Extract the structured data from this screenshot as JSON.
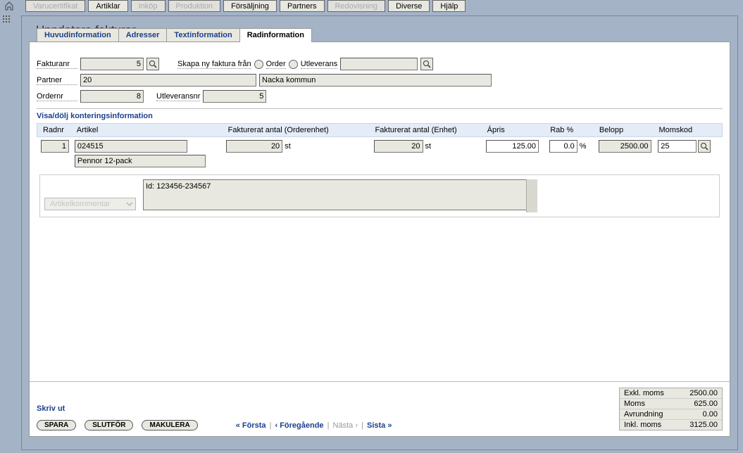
{
  "menu": {
    "items": [
      {
        "label": "Varucertifikat",
        "disabled": true
      },
      {
        "label": "Artiklar",
        "disabled": false
      },
      {
        "label": "Inköp",
        "disabled": true
      },
      {
        "label": "Produktion",
        "disabled": true
      },
      {
        "label": "Försäljning",
        "disabled": false
      },
      {
        "label": "Partners",
        "disabled": false
      },
      {
        "label": "Redovisning",
        "disabled": true
      },
      {
        "label": "Diverse",
        "disabled": false
      },
      {
        "label": "Hjälp",
        "disabled": false
      }
    ]
  },
  "page": {
    "title": "Uppdatera fakturor"
  },
  "tabs": [
    {
      "label": "Huvudinformation",
      "active": false
    },
    {
      "label": "Adresser",
      "active": false
    },
    {
      "label": "Textinformation",
      "active": false
    },
    {
      "label": "Radinformation",
      "active": true
    }
  ],
  "form": {
    "fakturanr_label": "Fakturanr",
    "fakturanr": "5",
    "skapa_label": "Skapa ny faktura från",
    "order_label": "Order",
    "utleverans_label": "Utleverans",
    "skapa_value": "",
    "partner_label": "Partner",
    "partner_code": "20",
    "partner_name": "Nacka kommun",
    "ordernr_label": "Ordernr",
    "ordernr": "8",
    "utleveransnr_label": "Utleveransnr",
    "utleveransnr": "5"
  },
  "section": {
    "toggle_label": "Visa/dölj konteringsinformation"
  },
  "grid": {
    "headers": {
      "radnr": "Radnr",
      "artikel": "Artikel",
      "fakt_order": "Fakturerat antal (Orderenhet)",
      "fakt_enhet": "Fakturerat antal (Enhet)",
      "apris": "Ápris",
      "rab": "Rab %",
      "belopp": "Belopp",
      "momskod": "Momskod"
    },
    "row": {
      "radnr": "1",
      "artikel_code": "024515",
      "artikel_name": "Pennor 12-pack",
      "qty_order": "20",
      "qty_order_unit": "st",
      "qty_unit": "20",
      "qty_unit_unit": "st",
      "apris": "125.00",
      "rab": "0.0",
      "rab_unit": "%",
      "belopp": "2500.00",
      "momskod": "25"
    },
    "comment": {
      "select_placeholder": "Artikelkommentar",
      "text": "Id: 123456-234567"
    }
  },
  "footer": {
    "print": "Skriv ut",
    "spara": "SPARA",
    "slutfor": "SLUTFÖR",
    "makulera": "MAKULERA",
    "nav": {
      "first": "« Första",
      "prev": "‹ Föregående",
      "next": "Nästa ›",
      "last": "Sista »"
    }
  },
  "totals": {
    "exkl_label": "Exkl. moms",
    "exkl": "2500.00",
    "moms_label": "Moms",
    "moms": "625.00",
    "avrund_label": "Avrundning",
    "avrund": "0.00",
    "inkl_label": "Inkl. moms",
    "inkl": "3125.00"
  }
}
